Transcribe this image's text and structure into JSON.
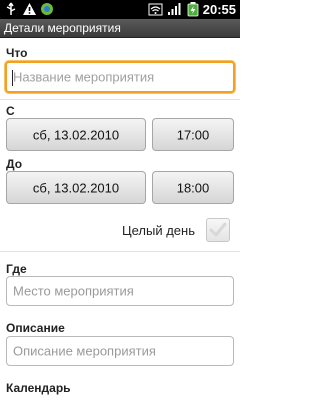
{
  "status_bar": {
    "time": "20:55",
    "icons": [
      "usb-icon",
      "warning-icon",
      "sync-icon",
      "wifi-icon",
      "signal-icon",
      "battery-charging-icon"
    ]
  },
  "title_bar": {
    "title": "Детали мероприятия"
  },
  "what": {
    "label": "Что",
    "placeholder": "Название мероприятия"
  },
  "from": {
    "label": "С",
    "date": "сб, 13.02.2010",
    "time": "17:00"
  },
  "to": {
    "label": "До",
    "date": "сб, 13.02.2010",
    "time": "18:00"
  },
  "all_day": {
    "label": "Целый день",
    "checked": false
  },
  "where": {
    "label": "Где",
    "placeholder": "Место мероприятия"
  },
  "description": {
    "label": "Описание",
    "placeholder": "Описание мероприятия"
  },
  "calendar": {
    "label": "Календарь"
  },
  "colors": {
    "focus": "#f3a11e",
    "title_bar": "#4a4a4a",
    "status_bar": "#000000"
  }
}
